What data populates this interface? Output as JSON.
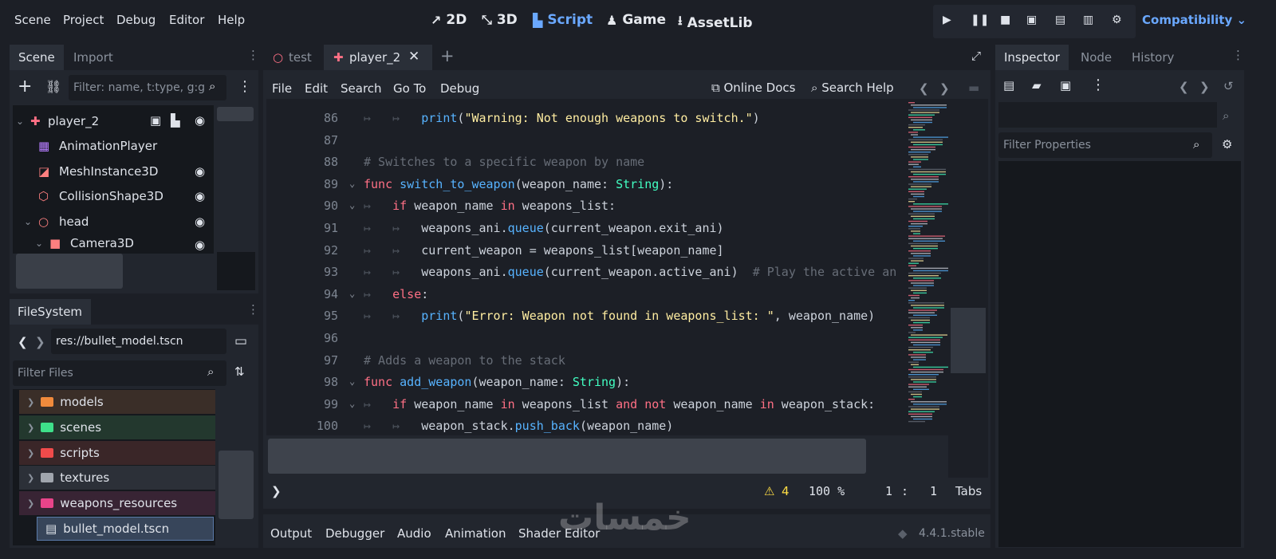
{
  "menu": [
    "Scene",
    "Project",
    "Debug",
    "Editor",
    "Help"
  ],
  "workspaces": [
    {
      "icon": "2d-icon",
      "glyph": "↗",
      "label": "2D"
    },
    {
      "icon": "3d-icon",
      "glyph": "⤡",
      "label": "3D"
    },
    {
      "icon": "script-icon",
      "glyph": "▙",
      "label": "Script"
    },
    {
      "icon": "game-icon",
      "glyph": "♟",
      "label": "Game"
    },
    {
      "icon": "assetlib-icon",
      "glyph": "⭳",
      "label": "AssetLib"
    }
  ],
  "renderer": "Compatibility",
  "scene_dock": {
    "tabs": [
      "Scene",
      "Import"
    ],
    "filter_placeholder": "Filter: name, t:type, g:g",
    "nodes": [
      {
        "name": "player_2",
        "icon": "✚",
        "color": "#ff7085"
      },
      {
        "name": "AnimationPlayer",
        "icon": "▦",
        "color": "#b67cff"
      },
      {
        "name": "MeshInstance3D",
        "icon": "◪",
        "color": "#fc7f7f"
      },
      {
        "name": "CollisionShape3D",
        "icon": "⬡",
        "color": "#fc7f7f"
      },
      {
        "name": "head",
        "icon": "○",
        "color": "#fc7f7f"
      },
      {
        "name": "Camera3D",
        "icon": "■",
        "color": "#fc7f7f"
      }
    ]
  },
  "filesystem": {
    "tab": "FileSystem",
    "path": "res://bullet_model.tscn",
    "filter_placeholder": "Filter Files",
    "folders": [
      {
        "name": "models",
        "color": "#f08a3c",
        "bg": "#3a2e28"
      },
      {
        "name": "scenes",
        "color": "#3ee08a",
        "bg": "#23382e"
      },
      {
        "name": "scripts",
        "color": "#f04b4b",
        "bg": "#3a2628"
      },
      {
        "name": "textures",
        "color": "#a0a5ad",
        "bg": "#2c3038"
      },
      {
        "name": "weapons_resources",
        "color": "#e8448a",
        "bg": "#382434"
      }
    ],
    "selected_file": "bullet_model.tscn"
  },
  "editor": {
    "tabs": [
      "test",
      "player_2"
    ],
    "menu": [
      "File",
      "Edit",
      "Search",
      "Go To",
      "Debug"
    ],
    "online_docs": "Online Docs",
    "search_help": "Search Help",
    "status": {
      "warnings": "4",
      "zoom": "100 %",
      "line": "1",
      "col": "1",
      "indent": "Tabs"
    }
  },
  "code_lines": [
    {
      "n": "86",
      "fold": "",
      "indent": 2,
      "html": "<span class='mt'>print</span>(<span class='str'>\"Warning: Not enough weapons to switch.\"</span>)"
    },
    {
      "n": "87",
      "fold": "",
      "indent": 0,
      "html": ""
    },
    {
      "n": "88",
      "fold": "",
      "indent": 0,
      "html": "<span class='cm'># Switches to a specific weapon by name</span>"
    },
    {
      "n": "89",
      "fold": "⌄",
      "indent": 0,
      "html": "<span class='kw'>func</span> <span class='fn'>switch_to_weapon</span>(weapon_name: <span class='ty'>String</span>):"
    },
    {
      "n": "90",
      "fold": "⌄",
      "indent": 1,
      "html": "<span class='kw'>if</span> weapon_name <span class='kw'>in</span> weapons_list:"
    },
    {
      "n": "91",
      "fold": "",
      "indent": 2,
      "html": "weapons_ani.<span class='mt'>queue</span>(current_weapon.exit_ani)"
    },
    {
      "n": "92",
      "fold": "",
      "indent": 2,
      "html": "current_weapon = weapons_list[weapon_name]"
    },
    {
      "n": "93",
      "fold": "",
      "indent": 2,
      "html": "weapons_ani.<span class='mt'>queue</span>(current_weapon.active_ani)  <span class='cm'># Play the active an</span>"
    },
    {
      "n": "94",
      "fold": "⌄",
      "indent": 1,
      "html": "<span class='kw'>else</span>:"
    },
    {
      "n": "95",
      "fold": "",
      "indent": 2,
      "html": "<span class='mt'>print</span>(<span class='str'>\"Error: Weapon not found in weapons_list: \"</span>, weapon_name)"
    },
    {
      "n": "96",
      "fold": "",
      "indent": 0,
      "html": ""
    },
    {
      "n": "97",
      "fold": "",
      "indent": 0,
      "html": "<span class='cm'># Adds a weapon to the stack</span>"
    },
    {
      "n": "98",
      "fold": "⌄",
      "indent": 0,
      "html": "<span class='kw'>func</span> <span class='fn'>add_weapon</span>(weapon_name: <span class='ty'>String</span>):"
    },
    {
      "n": "99",
      "fold": "⌄",
      "indent": 1,
      "html": "<span class='kw'>if</span> weapon_name <span class='kw'>in</span> weapons_list <span class='kw'>and not</span> weapon_name <span class='kw'>in</span> weapon_stack:"
    },
    {
      "n": "100",
      "fold": "",
      "indent": 2,
      "html": "weapon_stack.<span class='mt'>push_back</span>(weapon_name)"
    }
  ],
  "bottom_tabs": [
    "Output",
    "Debugger",
    "Audio",
    "Animation",
    "Shader Editor"
  ],
  "version": "4.4.1.stable",
  "inspector": {
    "tabs": [
      "Inspector",
      "Node",
      "History"
    ],
    "filter_placeholder": "Filter Properties"
  },
  "watermark": "خمسات"
}
